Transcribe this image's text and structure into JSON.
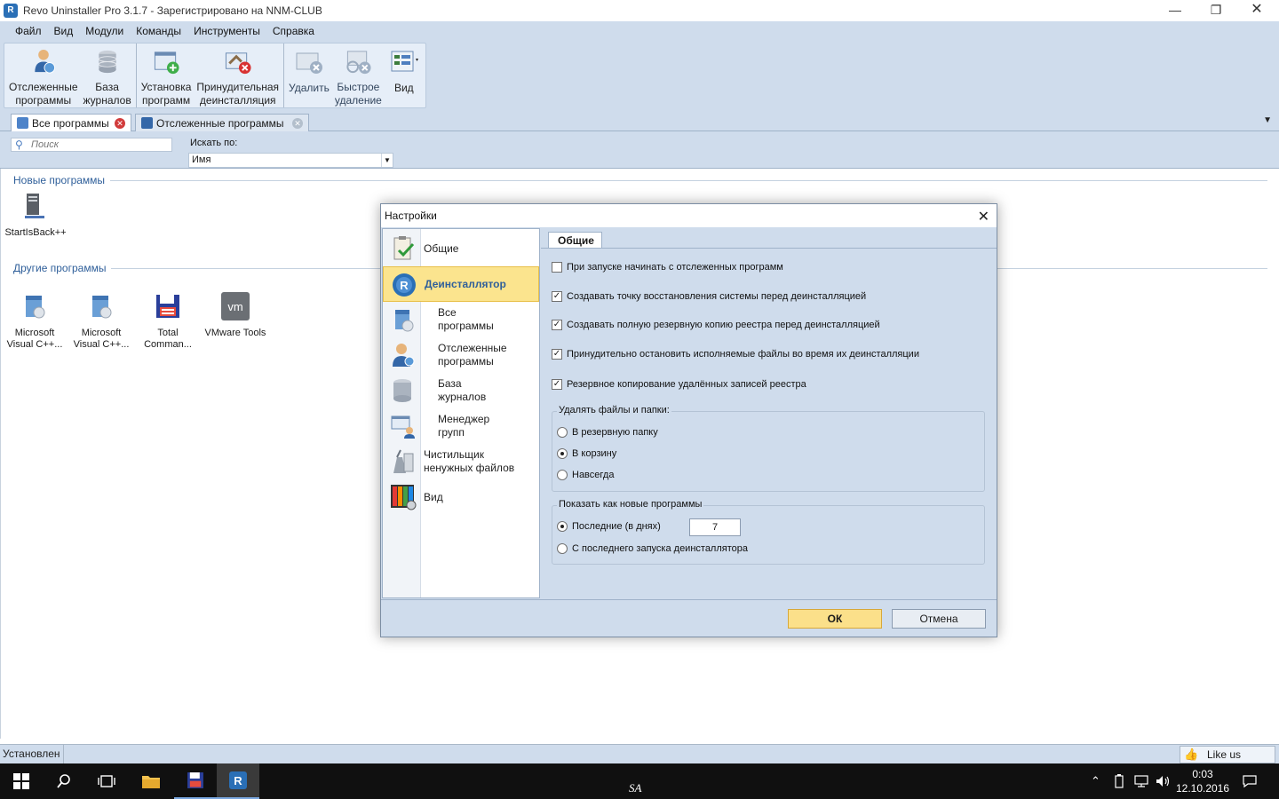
{
  "window": {
    "title": "Revo Uninstaller Pro 3.1.7 - Зарегистрировано на NNM-CLUB"
  },
  "menu": [
    "Файл",
    "Вид",
    "Модули",
    "Команды",
    "Инструменты",
    "Справка"
  ],
  "ribbon": {
    "buttons": [
      {
        "label": "Отслеженные\nпрограммы"
      },
      {
        "label": "База\nжурналов"
      },
      {
        "label": "Установка\nпрограмм"
      },
      {
        "label": "Принудительная\nдеинсталляция"
      },
      {
        "label": "Удалить"
      },
      {
        "label": "Быстрое\nудаление"
      },
      {
        "label": "Вид"
      }
    ]
  },
  "tabs": [
    {
      "label": "Все программы"
    },
    {
      "label": "Отслеженные программы"
    }
  ],
  "search": {
    "placeholder": "Поиск",
    "search_by_label": "Искать по:",
    "search_by_value": "Имя"
  },
  "content": {
    "new_programs_title": "Новые программы",
    "new_programs": [
      "StartIsBack++"
    ],
    "other_programs_title": "Другие программы",
    "other_programs": [
      "Microsoft\nVisual C++...",
      "Microsoft\nVisual C++...",
      "Total\nComman...",
      "VMware Tools"
    ]
  },
  "status": {
    "text": "Установлен",
    "like_label": "Like us"
  },
  "taskbar": {
    "sa_label": "SA",
    "time": "0:03",
    "date": "12.10.2016"
  },
  "dialog": {
    "title": "Настройки",
    "nav": [
      {
        "label": "Общие"
      },
      {
        "label": "Деинсталлятор"
      },
      {
        "label": "Все\nпрограммы"
      },
      {
        "label": "Отслеженные\nпрограммы"
      },
      {
        "label": "База\nжурналов"
      },
      {
        "label": "Менеджер\nгрупп"
      },
      {
        "label": "Чистильщик\nненужных файлов"
      },
      {
        "label": "Вид"
      }
    ],
    "tab_label": "Общие",
    "options": [
      {
        "label": "При запуске начинать с отслеженных программ",
        "checked": false
      },
      {
        "label": "Создавать точку восстановления системы перед деинсталляцией",
        "checked": true
      },
      {
        "label": "Создавать полную резервную копию реестра перед деинсталляцией",
        "checked": true
      },
      {
        "label": "Принудительно остановить исполняемые файлы во время их деинсталляции",
        "checked": true
      },
      {
        "label": "Резервное копирование удалённых записей реестра",
        "checked": true
      }
    ],
    "delete_group": {
      "label": "Удалять файлы и папки:",
      "options": [
        "В резервную папку",
        "В корзину",
        "Навсегда"
      ],
      "selected": 1
    },
    "show_new_group": {
      "label": "Показать как новые программы",
      "options": [
        "Последние (в днях)",
        "С последнего запуска деинсталлятора"
      ],
      "selected": 0,
      "days_value": "7"
    },
    "ok_label": "ОК",
    "cancel_label": "Отмена"
  },
  "colors": {
    "chrome": "#cfdcec",
    "selection": "#fbe48e",
    "accent_text": "#2f5f9a"
  }
}
